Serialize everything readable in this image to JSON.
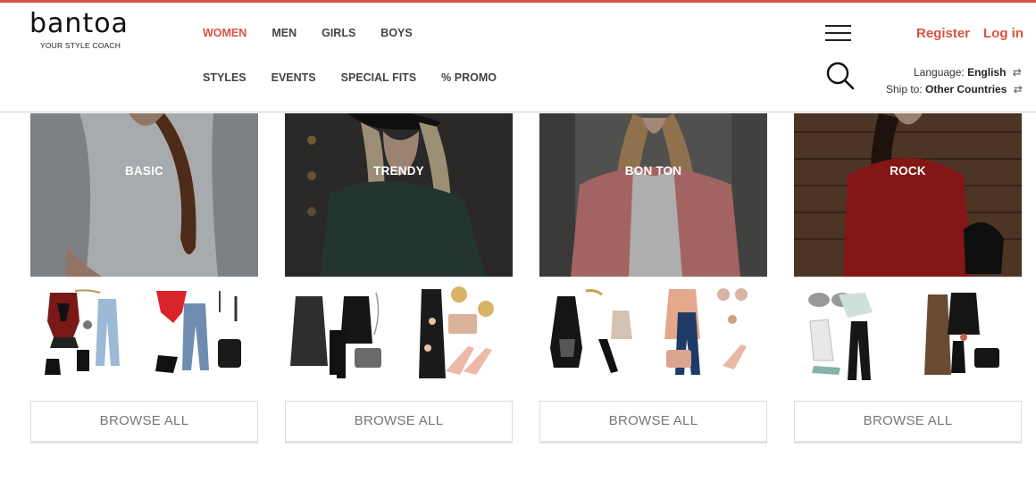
{
  "brand": {
    "name": "bantoa",
    "tagline": "YOUR STYLE COACH",
    "accent": "#d9533f"
  },
  "nav": {
    "primary": [
      {
        "label": "WOMEN",
        "active": true
      },
      {
        "label": "MEN",
        "active": false
      },
      {
        "label": "GIRLS",
        "active": false
      },
      {
        "label": "BOYS",
        "active": false
      }
    ],
    "secondary": [
      {
        "label": "STYLES"
      },
      {
        "label": "EVENTS"
      },
      {
        "label": "SPECIAL FITS"
      },
      {
        "label": "% PROMO"
      }
    ]
  },
  "icons": {
    "menu": "hamburger-menu-icon",
    "search": "search-icon",
    "swap": "swap-arrows-icon"
  },
  "auth": {
    "register": "Register",
    "login": "Log in"
  },
  "preferences": {
    "language_label": "Language:",
    "language_value": "English",
    "ship_label": "Ship to:",
    "ship_value": "Other Countries",
    "swap_glyph": "⇄"
  },
  "styles": [
    {
      "name": "BASIC",
      "browse": "BROWSE ALL"
    },
    {
      "name": "TRENDY",
      "browse": "BROWSE ALL"
    },
    {
      "name": "BON TON",
      "browse": "BROWSE ALL"
    },
    {
      "name": "ROCK",
      "browse": "BROWSE ALL"
    }
  ]
}
